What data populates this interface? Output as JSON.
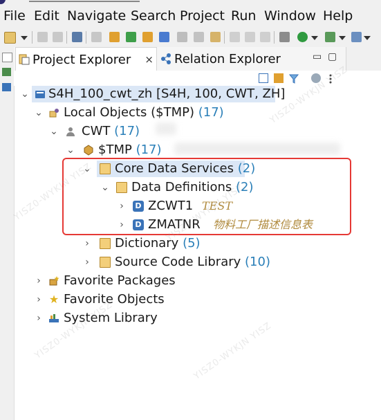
{
  "menubar": {
    "items": [
      "File",
      "Edit",
      "Navigate",
      "Search",
      "Project",
      "Run",
      "Window",
      "Help"
    ]
  },
  "toolbar": {
    "icons": [
      "new-icon",
      "save-icon",
      "save-all-icon",
      "console-icon",
      "link-icon",
      "open-type-icon",
      "open-resource-icon",
      "check-icon",
      "settings-icon",
      "search-icon",
      "run-icon",
      "debug-icon",
      "external-tools-icon"
    ]
  },
  "tabs": [
    {
      "label": "Project Explorer",
      "icon": "project-explorer-icon",
      "close": "×"
    },
    {
      "label": "Relation Explorer",
      "icon": "relation-explorer-icon"
    }
  ],
  "view_controls": {
    "minimize": "▭",
    "maximize": "▢"
  },
  "tree": {
    "project": {
      "label": "S4H_100_cwt_zh [S4H, 100, CWT, ZH]"
    },
    "local_objects": {
      "label": "Local Objects ($TMP)",
      "count": "(17)"
    },
    "cwt": {
      "label": "CWT",
      "count": "(17)"
    },
    "tmp": {
      "label": "$TMP",
      "count": "(17)"
    },
    "core_data_services": {
      "label": "Core Data Services",
      "count": "(2)"
    },
    "data_definitions": {
      "label": "Data Definitions",
      "count": "(2)"
    },
    "zcwt1": {
      "label": "ZCWT1",
      "desc": "TEST"
    },
    "zmatnr": {
      "label": "ZMATNR",
      "desc": "物料工厂描述信息表"
    },
    "dictionary": {
      "label": "Dictionary",
      "count": "(5)"
    },
    "source_code_library": {
      "label": "Source Code Library",
      "count": "(10)"
    },
    "favorite_packages": {
      "label": "Favorite Packages"
    },
    "favorite_objects": {
      "label": "Favorite Objects"
    },
    "system_library": {
      "label": "System Library"
    }
  },
  "colors": {
    "highlight_border": "#e53935",
    "count_text": "#2a7fb8",
    "description_text": "#b08a3d",
    "selection": "#dbe7f6"
  },
  "watermark": "YISZ0-WYKJN YISZ"
}
